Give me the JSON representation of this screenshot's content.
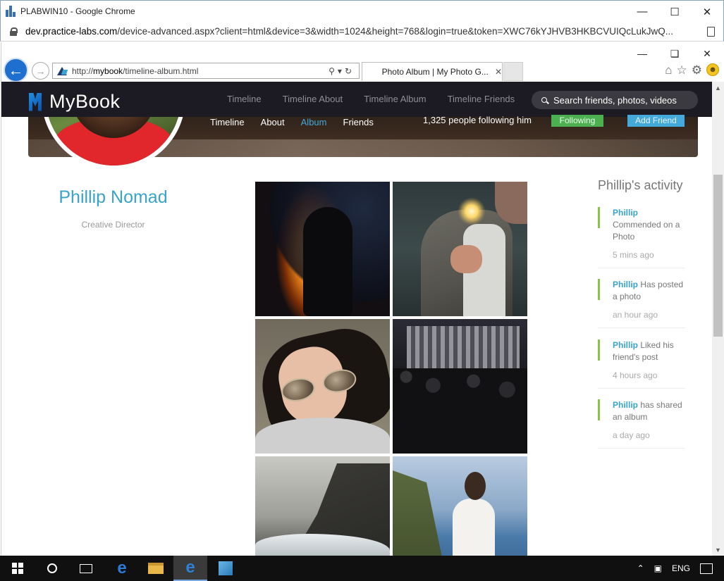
{
  "chrome": {
    "title": "PLABWIN10 - Google Chrome",
    "url_host": "dev.practice-labs.com",
    "url_rest": "/device-advanced.aspx?client=html&device=3&width=1024&height=768&login=true&token=XWC76kYJHVB3HKBCVUIQcLukJwQ..."
  },
  "ie": {
    "url_prefix": "http://",
    "url_host": "mybook",
    "url_path": "/timeline-album.html",
    "tab_title": "Photo Album | My Photo G..."
  },
  "mybook": {
    "brand": "MyBook",
    "nav": [
      "Timeline",
      "Timeline About",
      "Timeline Album",
      "Timeline Friends"
    ],
    "search_placeholder": "Search friends, photos, videos",
    "cover_nav": [
      "Timeline",
      "About",
      "Album",
      "Friends"
    ],
    "active_tab": "Album",
    "followers": "1,325 people following him",
    "following_button": "Following",
    "add_friend_button": "Add Friend"
  },
  "profile": {
    "name": "Phillip Nomad",
    "role": "Creative Director"
  },
  "activity": {
    "title": "Phillip's activity",
    "items": [
      {
        "user": "Phillip",
        "action": "Commended on a Photo",
        "time": "5 mins ago"
      },
      {
        "user": "Phillip",
        "action": "Has posted a photo",
        "time": "an hour ago"
      },
      {
        "user": "Phillip",
        "action": "Liked his friend's post",
        "time": "4 hours ago"
      },
      {
        "user": "Phillip",
        "action": "has shared an album",
        "time": "a day ago"
      }
    ]
  },
  "taskbar": {
    "language": "ENG"
  },
  "colors": {
    "accent": "#3aa3c9",
    "following": "#4caf50",
    "add_friend": "#44aadc",
    "nav_bg": "#1c1a22",
    "activity_bar": "#8bc34a"
  }
}
